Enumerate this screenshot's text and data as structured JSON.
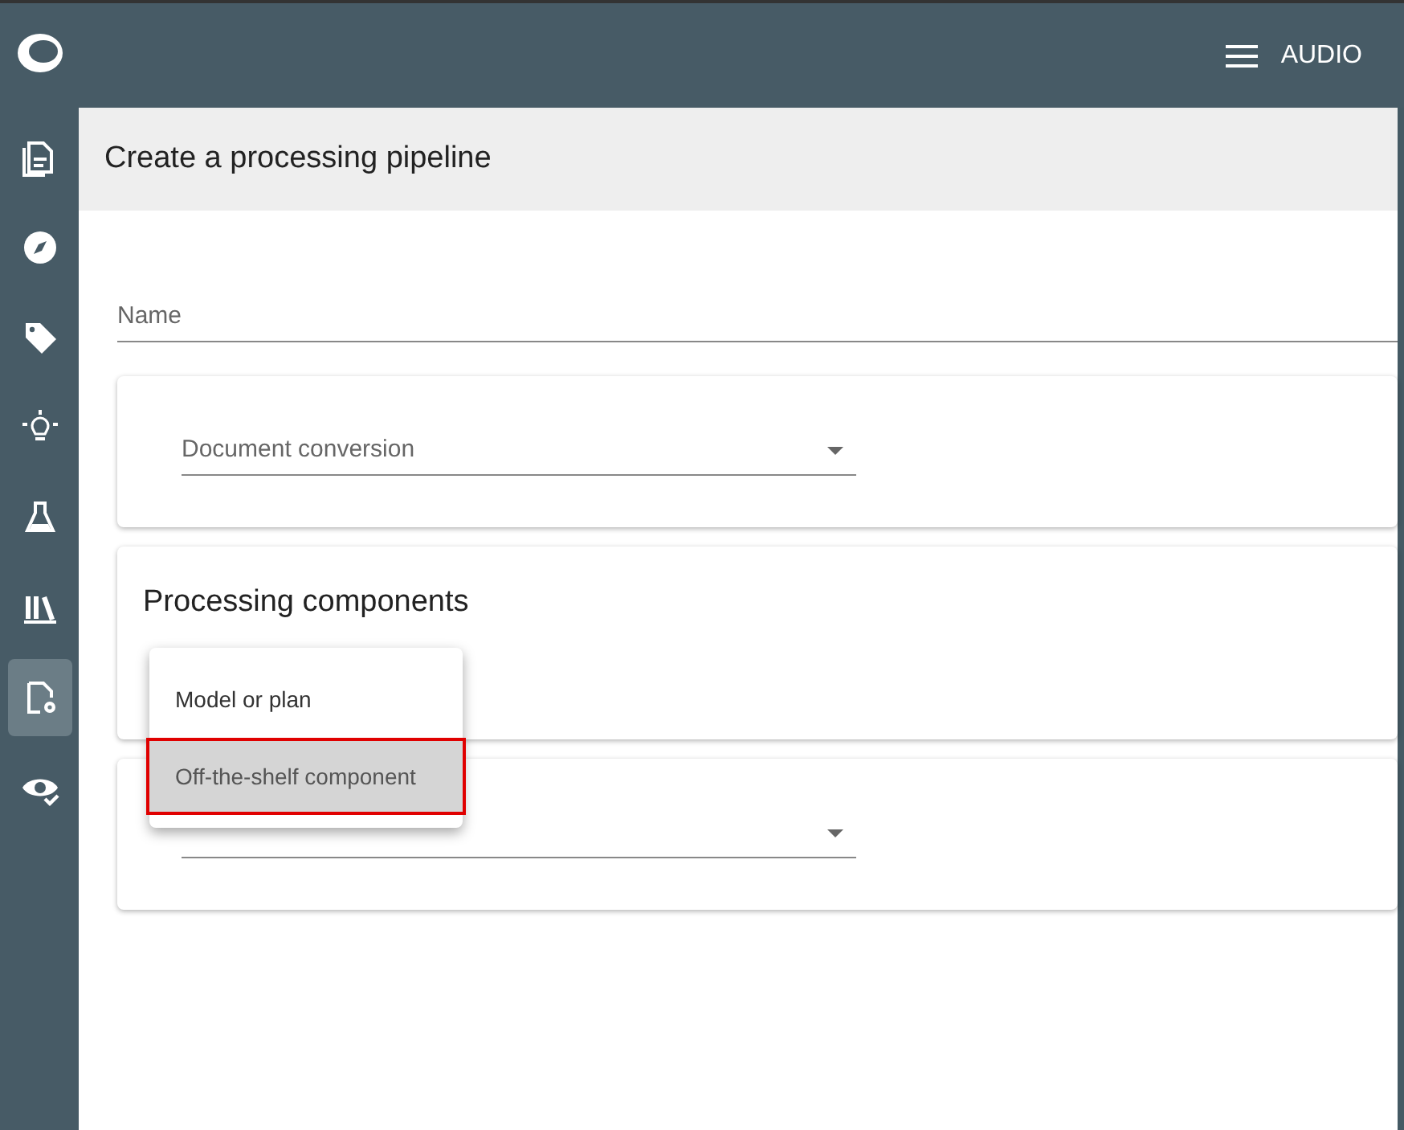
{
  "sidebar": {
    "items": [
      {
        "selected": false
      },
      {
        "selected": false
      },
      {
        "selected": false
      },
      {
        "selected": false
      },
      {
        "selected": false
      },
      {
        "selected": false
      },
      {
        "selected": true
      },
      {
        "selected": false
      }
    ]
  },
  "top_bar": {
    "menu_label": "AUDIO"
  },
  "page": {
    "title": "Create a processing pipeline"
  },
  "name_field": {
    "placeholder": "Name"
  },
  "conversion_card": {
    "select": {
      "placeholder": "Document conversion"
    }
  },
  "components_card": {
    "title": "Processing components"
  },
  "dropdown_menu": {
    "items": [
      {
        "label": "Model or plan",
        "selected": false
      },
      {
        "label": "Off-the-shelf component",
        "selected": true
      }
    ]
  }
}
